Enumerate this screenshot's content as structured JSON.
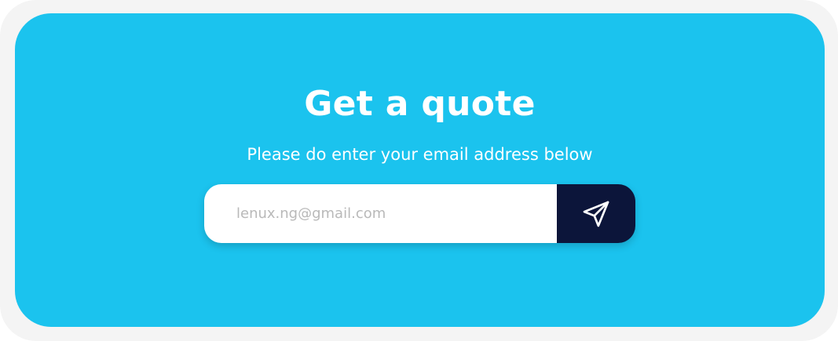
{
  "quote": {
    "title": "Get a quote",
    "subtitle": "Please do enter your email address below",
    "email_placeholder": "lenux.ng@gmail.com",
    "email_value": "",
    "send_icon": "send-paper-plane-icon"
  },
  "colors": {
    "card_background": "#1bc3ee",
    "outer_background": "#f4f4f4",
    "button_background": "#0c153a",
    "text": "#ffffff",
    "placeholder": "#b9b9b9"
  }
}
